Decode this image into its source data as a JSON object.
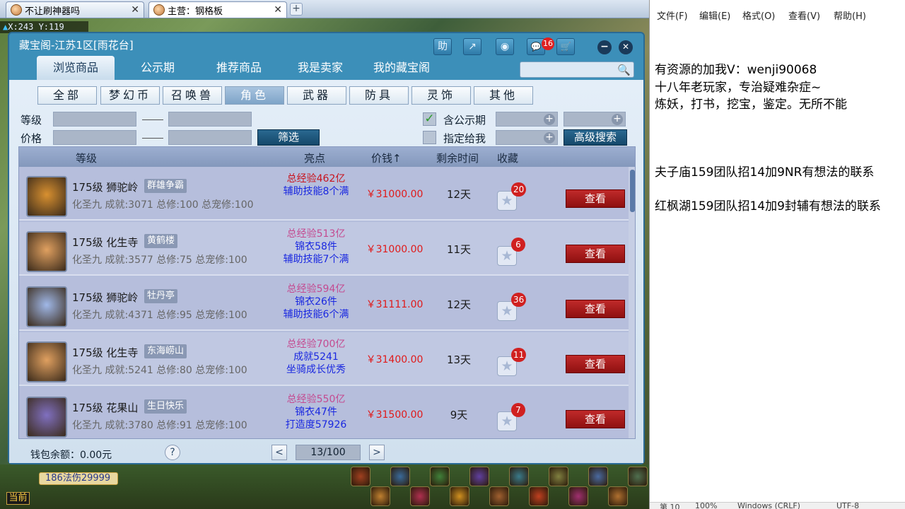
{
  "browser": {
    "tabs": [
      {
        "label": "不让刷神器吗"
      },
      {
        "label": "主营：钢格板"
      }
    ],
    "new_tab_label": "+"
  },
  "game": {
    "coords": "X:243 Y:119",
    "hp_info": "186法伤29999",
    "chat_label": "当前"
  },
  "window": {
    "title": "藏宝阁-江苏1区[雨花台]",
    "title_buttons": {
      "help": "助",
      "share": "↗",
      "record": "◉",
      "chat": "💬",
      "cart": "🛒"
    },
    "chat_badge": "16",
    "minimize": "−",
    "close": "✕",
    "tabs": [
      "浏览商品",
      "公示期",
      "推荐商品",
      "我是卖家",
      "我的藏宝阁"
    ],
    "search_placeholder": "",
    "search_icon": "🔍",
    "categories": [
      "全部",
      "梦幻币",
      "召唤兽",
      "角色",
      "武器",
      "防具",
      "灵饰",
      "其他"
    ],
    "filters": {
      "level_label": "等级",
      "price_label": "价格",
      "filter_button": "筛选",
      "include_public_label": "含公示期",
      "include_public_checked": true,
      "designated_label": "指定给我",
      "designated_checked": false,
      "advanced_button": "高级搜索",
      "check_mark": "✓",
      "plus_symbol": "+"
    },
    "list_headers": {
      "level": "等级",
      "highlights": "亮点",
      "price": "价钱↑",
      "time_left": "剩余时间",
      "favorite": "收藏"
    },
    "star_symbol": "★",
    "view_label": "查看",
    "rows": [
      {
        "level_school": "175级  狮驼岭",
        "tag": "群雄争霸",
        "stats": "化圣九  成就:3071  总修:100  总宠修:100",
        "highlights": [
          {
            "text": "总经验462亿",
            "cls": "hl-exp"
          },
          {
            "text": "辅助技能8个满",
            "cls": "hl-blue"
          }
        ],
        "price": "￥31000.00",
        "time_left": "12天",
        "favorites": "20",
        "avatar_color": "#d89030"
      },
      {
        "level_school": "175级  化生寺",
        "tag": "黄鹤楼",
        "stats": "化圣九  成就:3577  总修:75  总宠修:100",
        "highlights": [
          {
            "text": "总经验513亿",
            "cls": "hl-exp2"
          },
          {
            "text": "锦衣58件",
            "cls": "hl-blue"
          },
          {
            "text": "辅助技能7个满",
            "cls": "hl-blue"
          }
        ],
        "price": "￥31000.00",
        "time_left": "11天",
        "favorites": "6",
        "avatar_color": "#e0a060"
      },
      {
        "level_school": "175级  狮驼岭",
        "tag": "牡丹亭",
        "stats": "化圣九  成就:4371  总修:95  总宠修:100",
        "highlights": [
          {
            "text": "总经验594亿",
            "cls": "hl-exp2"
          },
          {
            "text": "锦衣26件",
            "cls": "hl-blue"
          },
          {
            "text": "辅助技能6个满",
            "cls": "hl-blue"
          }
        ],
        "price": "￥31111.00",
        "time_left": "12天",
        "favorites": "36",
        "avatar_color": "#a0b8e8"
      },
      {
        "level_school": "175级  化生寺",
        "tag": "东海崂山",
        "stats": "化圣九  成就:5241  总修:80  总宠修:100",
        "highlights": [
          {
            "text": "总经验700亿",
            "cls": "hl-exp2"
          },
          {
            "text": "成就5241",
            "cls": "hl-blue"
          },
          {
            "text": "坐骑成长优秀",
            "cls": "hl-blue"
          }
        ],
        "price": "￥31400.00",
        "time_left": "13天",
        "favorites": "11",
        "avatar_color": "#e0a060"
      },
      {
        "level_school": "175级  花果山",
        "tag": "生日快乐",
        "stats": "化圣九  成就:3780  总修:91  总宠修:100",
        "highlights": [
          {
            "text": "总经验550亿",
            "cls": "hl-exp2"
          },
          {
            "text": "锦衣47件",
            "cls": "hl-blue"
          },
          {
            "text": "打造度57926",
            "cls": "hl-blue"
          }
        ],
        "price": "￥31500.00",
        "time_left": "9天",
        "favorites": "7",
        "avatar_color": "#8070c0"
      }
    ],
    "wallet": "钱包余额：0.00元",
    "help_icon": "?",
    "prev_page": "<",
    "next_page": ">",
    "page": "13/100"
  },
  "notepad": {
    "menu": [
      "文件(F)",
      "编辑(E)",
      "格式(O)",
      "查看(V)",
      "帮助(H)"
    ],
    "lines": [
      "有资源的加我V：wenji90068",
      "十八年老玩家，专治疑难杂症~",
      "炼妖，打书，挖宝，鉴定。无所不能",
      "夫子庙159团队招14加9NR有想法的联系",
      "红枫湖159团队招14加9封辅有想法的联系"
    ],
    "status": [
      "第 10",
      "100%",
      "Windows (CRLF)",
      "UTF-8"
    ]
  }
}
